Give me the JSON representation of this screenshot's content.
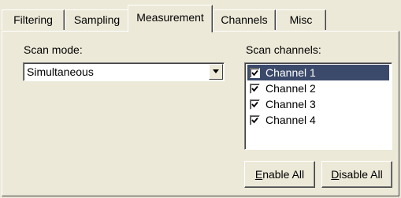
{
  "tabs": [
    {
      "label": "Filtering"
    },
    {
      "label": "Sampling"
    },
    {
      "label": "Measurement",
      "active": true
    },
    {
      "label": "Channels"
    },
    {
      "label": "Misc"
    }
  ],
  "scan_mode": {
    "label": "Scan mode:",
    "value": "Simultaneous"
  },
  "scan_channels": {
    "label": "Scan channels:",
    "items": [
      {
        "label": "Channel 1",
        "checked": true,
        "selected": true
      },
      {
        "label": "Channel 2",
        "checked": true
      },
      {
        "label": "Channel 3",
        "checked": true
      },
      {
        "label": "Channel 4",
        "checked": true
      }
    ]
  },
  "buttons": {
    "enable_all": {
      "accel": "E",
      "rest": "nable All"
    },
    "disable_all": {
      "accel": "D",
      "rest": "isable All"
    }
  },
  "colors": {
    "face": "#ece9d8",
    "selection": "#3b4a6b"
  }
}
